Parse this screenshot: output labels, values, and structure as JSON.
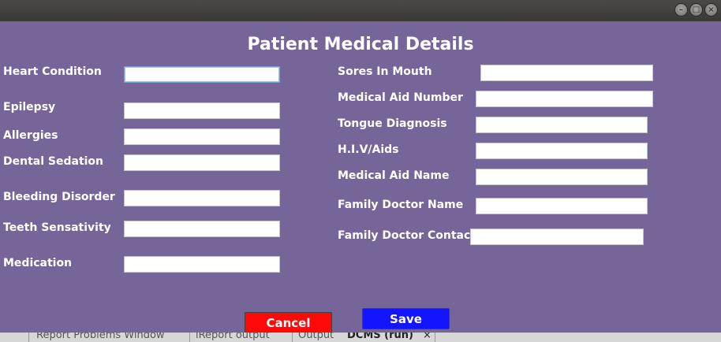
{
  "window": {
    "title": "Patient Medical Details"
  },
  "window_controls": {
    "minimize": "–",
    "maximize": "□",
    "close": "×"
  },
  "form": {
    "left_fields": [
      {
        "label": "Heart Condition",
        "value": ""
      },
      {
        "label": "Epilepsy",
        "value": ""
      },
      {
        "label": "Allergies",
        "value": ""
      },
      {
        "label": "Dental Sedation",
        "value": ""
      },
      {
        "label": "Bleeding Disorder",
        "value": ""
      },
      {
        "label": "Teeth Sensativity",
        "value": ""
      },
      {
        "label": "Medication",
        "value": ""
      }
    ],
    "right_fields": [
      {
        "label": "Sores In Mouth",
        "value": ""
      },
      {
        "label": "Medical Aid Number",
        "value": ""
      },
      {
        "label": "Tongue Diagnosis",
        "value": ""
      },
      {
        "label": "H.I.V/Aids",
        "value": ""
      },
      {
        "label": "Medical Aid Name",
        "value": ""
      },
      {
        "label": "Family Doctor Name",
        "value": ""
      },
      {
        "label": "Family Doctor Contact",
        "value": ""
      }
    ]
  },
  "buttons": {
    "cancel": "Cancel",
    "save": "Save"
  },
  "colors": {
    "panel_bg": "#756598",
    "cancel_bg": "#ff0808",
    "save_bg": "#1414ff"
  },
  "taskbar": {
    "tabs": [
      "Report Problems Window",
      "iReport output",
      "Output",
      "DCMS (run)"
    ],
    "close_glyph": "×"
  }
}
